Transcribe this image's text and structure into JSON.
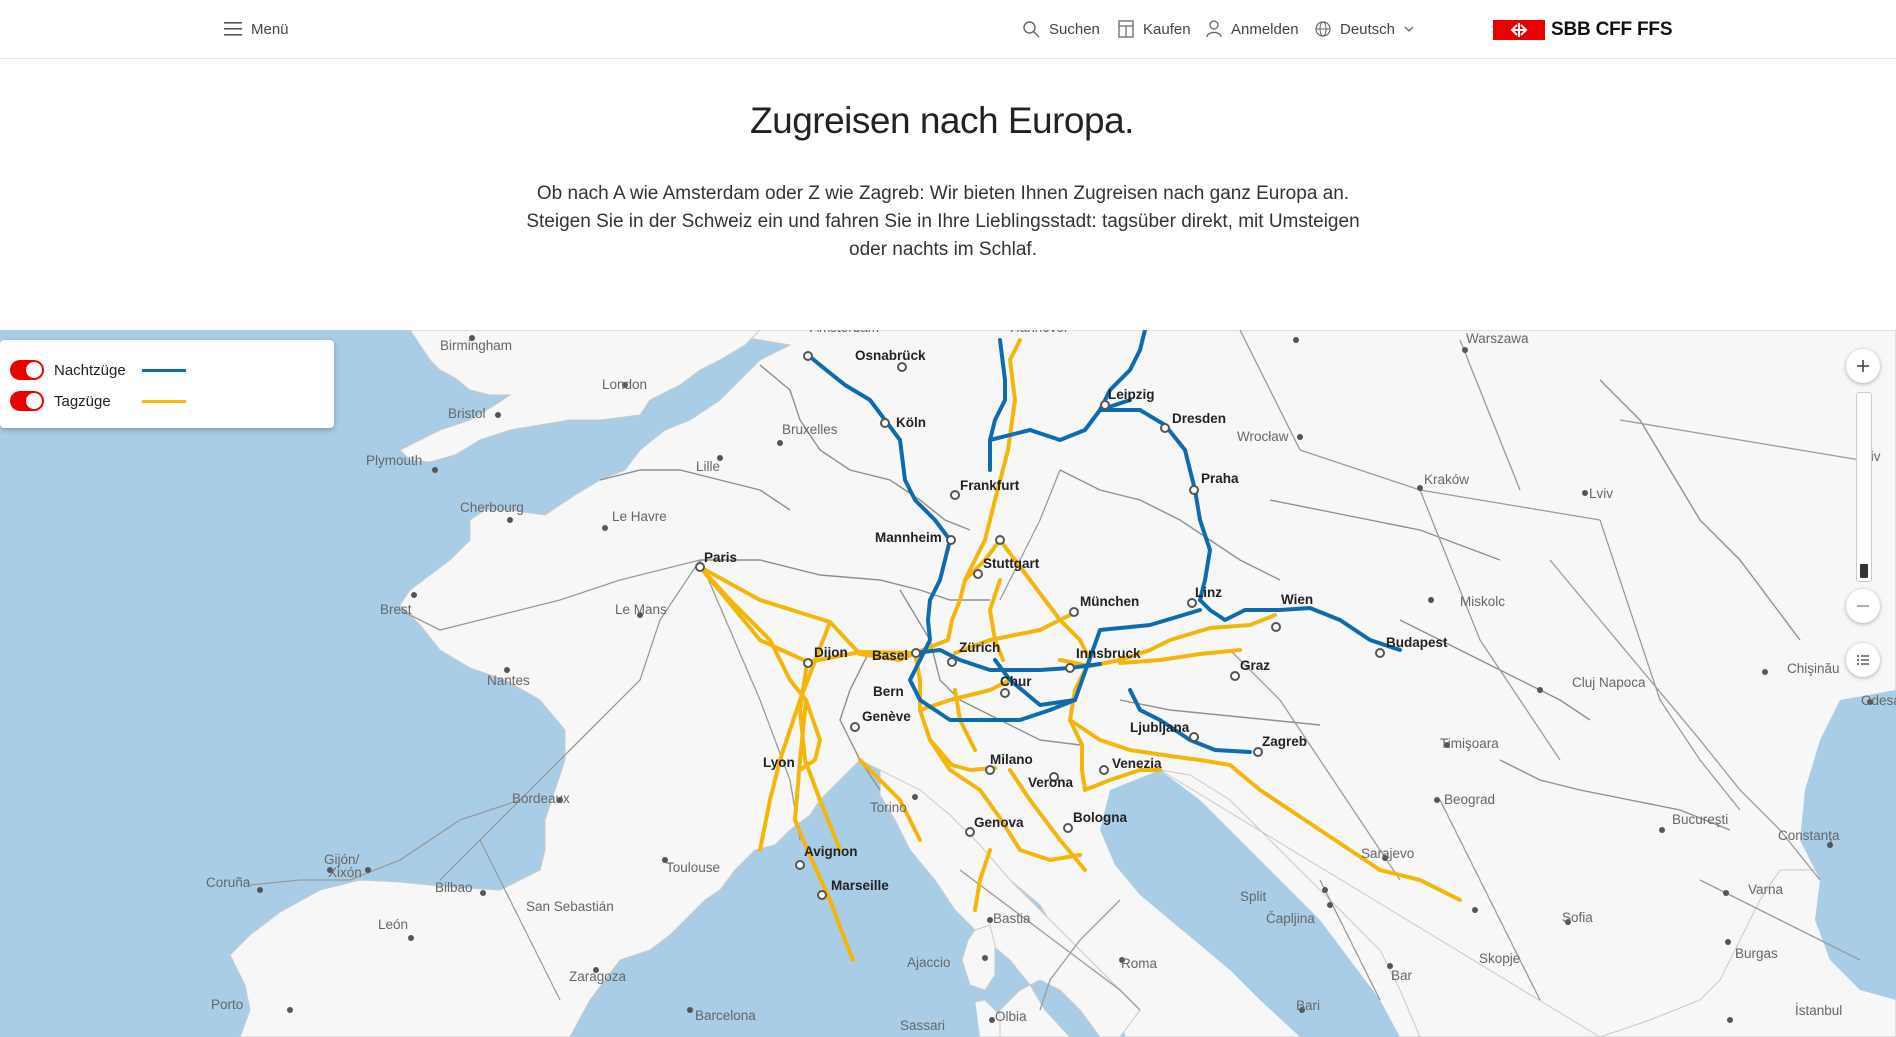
{
  "header": {
    "menu_label": "Menü",
    "search_label": "Suchen",
    "buy_label": "Kaufen",
    "login_label": "Anmelden",
    "language_label": "Deutsch",
    "logo_text": "SBB CFF FFS",
    "brand_color": "#eb0000"
  },
  "intro": {
    "title": "Zugreisen nach Europa.",
    "text": "Ob nach A wie Amsterdam oder Z wie Zagreb: Wir bieten Ihnen Zugreisen nach ganz Europa an. Steigen Sie in der Schweiz ein und fahren Sie in Ihre Lieblingsstadt: tagsüber direkt, mit Umsteigen oder nachts im Schlaf."
  },
  "legend": {
    "night": {
      "label": "Nachtzüge",
      "color": "#0f6bb0",
      "enabled": true
    },
    "day": {
      "label": "Tagzüge",
      "color": "#f2b70a",
      "enabled": true
    }
  },
  "map": {
    "major_cities": [
      "Osnabrück",
      "Köln",
      "Frankfurt",
      "Mannheim",
      "Stuttgart",
      "Leipzig",
      "Dresden",
      "Praha",
      "München",
      "Linz",
      "Wien",
      "Budapest",
      "Graz",
      "Innsbruck",
      "Zürich",
      "Basel",
      "Bern",
      "Genève",
      "Chur",
      "Dijon",
      "Paris",
      "Lyon",
      "Avignon",
      "Marseille",
      "Milano",
      "Verona",
      "Venezia",
      "Bologna",
      "Genova",
      "Ljubljana",
      "Zagreb"
    ],
    "minor_cities": [
      "Amsterdam",
      "Hannover",
      "Warszawa",
      "Birmingham",
      "London",
      "Bristol",
      "Plymouth",
      "Bruxelles",
      "Lille",
      "Cherbourg",
      "Le Havre",
      "Brest",
      "Le Mans",
      "Nantes",
      "Bordeaux",
      "Toulouse",
      "Torino",
      "Gijón/ Xixón",
      "Coruña",
      "Bilbao",
      "San Sebastián",
      "León",
      "Zaragoza",
      "Porto",
      "Barcelona",
      "Bastia",
      "Ajaccio",
      "Sassari",
      "Olbia",
      "Roma",
      "Bari",
      "Split",
      "Čapljina",
      "Sarajevo",
      "Beograd",
      "Timişoara",
      "Cluj Napoca",
      "Miskolc",
      "Kraków",
      "Wrocław",
      "Lviv",
      "Kyiv",
      "Chişinău",
      "Odesa",
      "Bucureşti",
      "Constanţa",
      "Varna",
      "Sofia",
      "Burgas",
      "Skopje",
      "Bar",
      "İstanbul"
    ],
    "zoom_in_icon": "plus-icon",
    "zoom_out_icon": "minus-icon",
    "list_icon": "list-icon"
  }
}
